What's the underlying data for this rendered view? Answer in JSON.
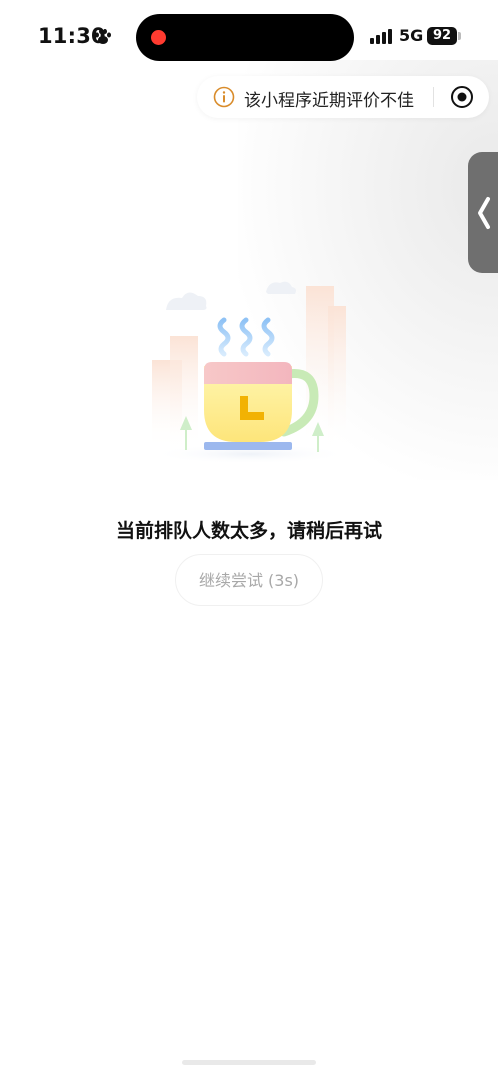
{
  "status_bar": {
    "time": "11:30",
    "network": "5G",
    "battery": "92",
    "icons": [
      "paw-icon",
      "recording-dot-icon",
      "signal-icon"
    ]
  },
  "review_banner": {
    "text": "该小程序近期评价不佳",
    "icon": "info-icon",
    "accent_color": "#d98c2b"
  },
  "capsule": {
    "icon": "record-target-icon"
  },
  "side_tab": {
    "icon": "chevron-left-icon"
  },
  "illustration": {
    "name": "tea-cup-waiting-illustration"
  },
  "queue": {
    "message": "当前排队人数太多，请稍后再试",
    "retry_label": "继续尝试 (3s)"
  }
}
